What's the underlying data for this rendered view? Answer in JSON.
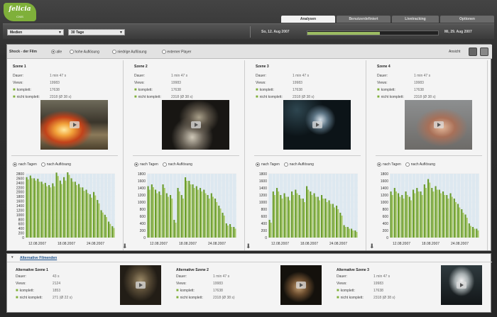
{
  "app": {
    "logo": "felicia",
    "logo_sub": "CMS"
  },
  "tabs": [
    "Analysen",
    "Benutzerdefiniert",
    "Livetracking",
    "Optionen"
  ],
  "toolbar": {
    "media_select": "Medien",
    "range_select": "30 Tage",
    "date_from": "So, 12. Aug 2007",
    "date_to": "Mi, 29. Aug 2007"
  },
  "filter": {
    "label": "Shock - der Film",
    "options": [
      "alle",
      "hohe Auflösung",
      "niedrige Auflösung",
      "externer Player"
    ],
    "selected": 0,
    "view_label": "Ansicht"
  },
  "scenes": [
    {
      "title": "Szene 1",
      "fields": [
        {
          "label": "Dauer:",
          "value": "1 min 47 s"
        },
        {
          "label": "Views:",
          "value": "19983"
        },
        {
          "label": "komplett:",
          "value": "17638"
        },
        {
          "label": "nicht komplett:",
          "value": "2318 (Ø 38 s)"
        }
      ],
      "image": "fire-explosion",
      "chart_data": {
        "type": "bar",
        "ylim": [
          0,
          2800
        ],
        "yticks": [
          0,
          200,
          400,
          600,
          800,
          1000,
          1200,
          1400,
          1600,
          1800,
          2000,
          2200,
          2400,
          2600,
          2800
        ],
        "xticks": [
          "12.08.2007",
          "18.08.2007",
          "24.08.2007"
        ],
        "series": [
          {
            "values": [
              2650,
              2720,
              2600,
              2580,
              2450,
              2400,
              2300,
              2380,
              2850,
              2500,
              2650,
              2900,
              2600,
              2450,
              2350,
              2200,
              2100,
              1900,
              2000,
              1650,
              1200,
              1000,
              700,
              500
            ]
          },
          {
            "values": [
              2550,
              2600,
              2500,
              2450,
              2350,
              2250,
              2200,
              2250,
              2700,
              2350,
              2500,
              2750,
              2450,
              2300,
              2200,
              2050,
              1950,
              1750,
              1850,
              1500,
              1100,
              900,
              600,
              420
            ]
          }
        ]
      }
    },
    {
      "title": "Szene 2",
      "fields": [
        {
          "label": "Dauer:",
          "value": "1 min 47 s"
        },
        {
          "label": "Views:",
          "value": "19983"
        },
        {
          "label": "komplett:",
          "value": "17638"
        },
        {
          "label": "nicht komplett:",
          "value": "2318 (Ø 38 s)"
        }
      ],
      "image": "hands-in-dark",
      "chart_data": {
        "type": "bar",
        "ylim": [
          0,
          1800
        ],
        "yticks": [
          0,
          200,
          400,
          600,
          800,
          1000,
          1200,
          1400,
          1600,
          1800
        ],
        "xticks": [
          "12.08.2007",
          "18.08.2007",
          "24.08.2007"
        ],
        "series": [
          {
            "values": [
              1450,
              1500,
              1350,
              1300,
              1500,
              1250,
              1200,
              500,
              1400,
              1200,
              1700,
              1600,
              1500,
              1450,
              1400,
              1350,
              1200,
              1250,
              1100,
              900,
              700,
              400,
              380,
              300
            ]
          },
          {
            "values": [
              1350,
              1420,
              1250,
              1200,
              1400,
              1150,
              1100,
              420,
              1300,
              1100,
              1600,
              1500,
              1400,
              1350,
              1300,
              1250,
              1100,
              1150,
              1000,
              820,
              620,
              340,
              300,
              250
            ]
          }
        ]
      }
    },
    {
      "title": "Szene 3",
      "fields": [
        {
          "label": "Dauer:",
          "value": "1 min 47 s"
        },
        {
          "label": "Views:",
          "value": "19983"
        },
        {
          "label": "komplett:",
          "value": "17638"
        },
        {
          "label": "nicht komplett:",
          "value": "2318 (Ø 38 s)"
        }
      ],
      "image": "figure-underwater",
      "chart_data": {
        "type": "bar",
        "ylim": [
          0,
          1800
        ],
        "yticks": [
          0,
          200,
          400,
          600,
          800,
          1000,
          1200,
          1400,
          1600,
          1800
        ],
        "xticks": [
          "12.08.2007",
          "18.08.2007",
          "24.08.2007"
        ],
        "series": [
          {
            "values": [
              500,
              1300,
              1400,
              1200,
              1250,
              1150,
              1300,
              1350,
              1200,
              1100,
              1450,
              1300,
              1250,
              1150,
              1200,
              1100,
              1050,
              950,
              900,
              700,
              350,
              300,
              250,
              200
            ]
          },
          {
            "values": [
              420,
              1200,
              1300,
              1100,
              1150,
              1050,
              1200,
              1250,
              1100,
              1000,
              1350,
              1200,
              1150,
              1050,
              1100,
              1000,
              950,
              850,
              800,
              620,
              300,
              250,
              200,
              160
            ]
          }
        ]
      }
    },
    {
      "title": "Szene 4",
      "fields": [
        {
          "label": "Dauer:",
          "value": "1 min 47 s"
        },
        {
          "label": "Views:",
          "value": "19983"
        },
        {
          "label": "komplett:",
          "value": "17638"
        },
        {
          "label": "nicht komplett:",
          "value": "2318 (Ø 38 s)"
        }
      ],
      "image": "face-closeup",
      "chart_data": {
        "type": "bar",
        "ylim": [
          0,
          1800
        ],
        "yticks": [
          0,
          200,
          400,
          600,
          800,
          1000,
          1200,
          1400,
          1600,
          1800
        ],
        "xticks": [
          "12.08.2007",
          "18.08.2007",
          "24.08.2007"
        ],
        "series": [
          {
            "values": [
              1300,
              1400,
              1250,
              1200,
              1300,
              1150,
              1350,
              1400,
              1300,
              1500,
              1650,
              1400,
              1450,
              1350,
              1300,
              1200,
              1250,
              1100,
              950,
              800,
              650,
              400,
              300,
              250
            ]
          },
          {
            "values": [
              1200,
              1300,
              1150,
              1100,
              1200,
              1050,
              1250,
              1300,
              1200,
              1400,
              1550,
              1300,
              1350,
              1250,
              1200,
              1100,
              1150,
              1000,
              850,
              700,
              560,
              330,
              250,
              200
            ]
          }
        ]
      }
    }
  ],
  "mode_labels": [
    "nach Tagen",
    "nach Auflösung"
  ],
  "alternatives": {
    "header": "Alternative Filmenden",
    "items": [
      {
        "title": "Alternative Szene 1",
        "fields": [
          {
            "label": "Dauer:",
            "value": "43 s"
          },
          {
            "label": "Views:",
            "value": "2124"
          },
          {
            "label": "komplett:",
            "value": "1853"
          },
          {
            "label": "nicht komplett:",
            "value": "271 (Ø 22 s)"
          }
        ],
        "image": "dim-corridor"
      },
      {
        "title": "Alternative Szene 2",
        "fields": [
          {
            "label": "Dauer:",
            "value": "1 min 47 s"
          },
          {
            "label": "Views:",
            "value": "19983"
          },
          {
            "label": "komplett:",
            "value": "17638"
          },
          {
            "label": "nicht komplett:",
            "value": "2318 (Ø 38 s)"
          }
        ],
        "image": "person-in-dark"
      },
      {
        "title": "Alternative Szene 3",
        "fields": [
          {
            "label": "Dauer:",
            "value": "1 min 47 s"
          },
          {
            "label": "Views:",
            "value": "19983"
          },
          {
            "label": "komplett:",
            "value": "17638"
          },
          {
            "label": "nicht komplett:",
            "value": "2318 (Ø 38 s)"
          }
        ],
        "image": "screaming-face"
      }
    ]
  },
  "colors": {
    "accent": "#7fb03a",
    "bar_dark": "#6a9c2e",
    "bar_light": "#a8c868"
  }
}
